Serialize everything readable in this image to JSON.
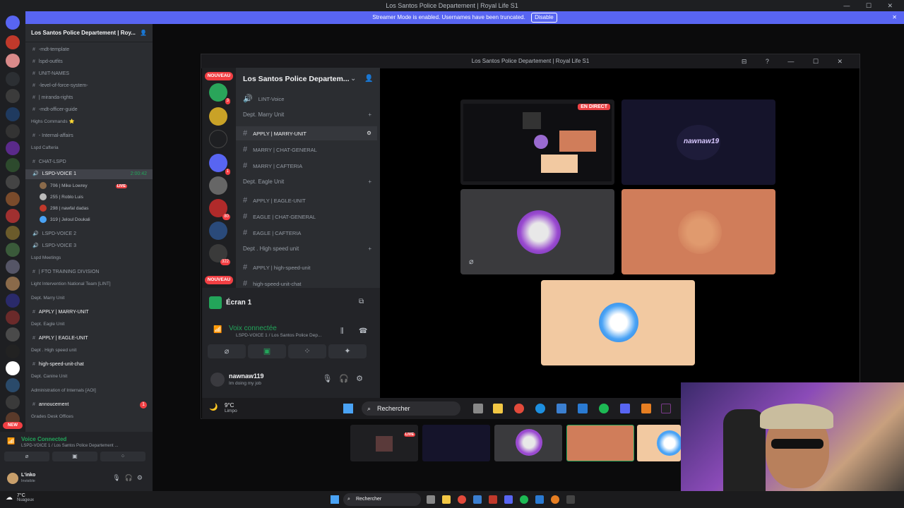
{
  "window": {
    "title": "Los Santos Police Departement | Royal Life S1",
    "controls": "— ☐ ✕"
  },
  "streamer_banner": {
    "text": "Streamer Mode is enabled. Usernames have been truncated.",
    "button": "Disable",
    "close": "✕"
  },
  "sidebar": {
    "server_name": "Los Santos Police Departement | Roy...",
    "channels": [
      {
        "label": "-mdt-template",
        "type": "text"
      },
      {
        "label": "lspd-outfits",
        "type": "text"
      },
      {
        "label": "UNIT-NAMES",
        "type": "text"
      },
      {
        "label": "-level-of-force-system-",
        "type": "text"
      },
      {
        "label": "| miranda-rights",
        "type": "text"
      },
      {
        "label": "-mdt-officer-guide",
        "type": "text"
      },
      {
        "label": "Highs Commands ⭐",
        "type": "category"
      },
      {
        "label": "- Internal-affairs",
        "type": "text"
      },
      {
        "label": "Lspd Cafteria",
        "type": "category"
      },
      {
        "label": "CHAT-LSPD",
        "type": "text"
      },
      {
        "label": "LSPD-VOICE 1",
        "type": "voice-active",
        "right": "2:00:42"
      }
    ],
    "voice_users": [
      {
        "label": "706 | Mike Lowrey",
        "badge": "LIVE"
      },
      {
        "label": "255 | Roblo Luis",
        "badge": ""
      },
      {
        "label": "298 | nawfal dadas",
        "badge": ""
      },
      {
        "label": "319 | Jeloul Doukali",
        "badge": ""
      }
    ],
    "channels2": [
      {
        "label": "LSPD-VOICE 2",
        "type": "voice"
      },
      {
        "label": "LSPD-VOICE 3",
        "type": "voice"
      },
      {
        "label": "Lspd Meetings",
        "type": "category"
      },
      {
        "label": "| FTO TRAINING DIVISION",
        "type": "text"
      },
      {
        "label": "Light Intervention National Team [LINT]",
        "type": "category"
      },
      {
        "label": "Dept. Marry Unit",
        "type": "category"
      },
      {
        "label": "APPLY | MARRY-UNIT",
        "type": "text-bold"
      },
      {
        "label": "Dept. Eagle Unit",
        "type": "category"
      },
      {
        "label": "APPLY | EAGLE-UNIT",
        "type": "text-bold"
      },
      {
        "label": "Dept . High speed unit",
        "type": "category"
      },
      {
        "label": "high-speed-unit-chat",
        "type": "text-bold"
      },
      {
        "label": "Dept. Canine Unit",
        "type": "category"
      },
      {
        "label": "Administration of Internals [AOI]",
        "type": "category"
      },
      {
        "label": "annoucement",
        "type": "text-bold",
        "right": "1"
      },
      {
        "label": "Grades Desk Offices",
        "type": "category"
      }
    ]
  },
  "voice_panel": {
    "status": "Voice Connected",
    "channel": "LSPD-VOICE 1 / Los Santos Police Departement ...",
    "username": "L'inko",
    "user_status": "Invisible",
    "new_badge": "NEW"
  },
  "popout": {
    "title": "Los Santos Police Departement | Royal Life S1",
    "server_name": "Los Santos Police Departem...",
    "nouveau": "NOUVEAU",
    "channels": [
      {
        "label": "LINT-Voice",
        "kind": "voice"
      },
      {
        "label": "Dept. Marry Unit",
        "kind": "category"
      },
      {
        "label": "APPLY | MARRY-UNIT",
        "kind": "text",
        "active": true
      },
      {
        "label": "MARRY | CHAT-GENERAL",
        "kind": "text"
      },
      {
        "label": "MARRY | CAFTERIA",
        "kind": "text"
      },
      {
        "label": "Dept. Eagle Unit",
        "kind": "category"
      },
      {
        "label": "APPLY | EAGLE-UNIT",
        "kind": "text"
      },
      {
        "label": "EAGLE | CHAT-GENERAL",
        "kind": "text"
      },
      {
        "label": "EAGLE | CAFTERIA",
        "kind": "text"
      },
      {
        "label": "Dept . High speed unit",
        "kind": "category"
      },
      {
        "label": "APPLY | high-speed-unit",
        "kind": "text"
      },
      {
        "label": "high-speed-unit-chat",
        "kind": "text"
      }
    ],
    "screen": "Écran 1",
    "voice_connected": "Voix connectée",
    "voice_sub": "LSPD-VOICE 1 / Los Santos Police Dep...",
    "username": "nawnaw119",
    "user_status": "Im doing my job",
    "live_label": "EN DIRECT",
    "tile_name": "nawnaw19"
  },
  "inner_taskbar": {
    "temp": "9°C",
    "weather": "Limpo",
    "search": "Rechercher"
  },
  "taskbar": {
    "temp": "7°C",
    "weather": "Nuageux",
    "search": "Rechercher"
  },
  "thumbs": {
    "live": "LIVE"
  },
  "colors": {
    "blurple": "#5865f2",
    "green": "#23a55a",
    "red": "#ed4245",
    "tile_orange": "#d07d5a",
    "tile_peach": "#f2c9a1",
    "tile_gray": "#3a3a3d",
    "tile_navy": "#15142b"
  }
}
